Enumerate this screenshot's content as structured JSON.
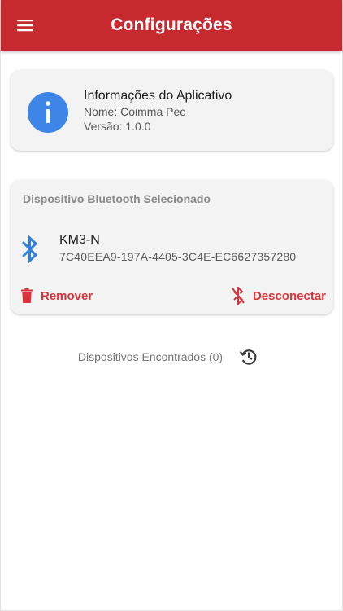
{
  "appbar": {
    "title": "Configurações",
    "bg_color": "#c62a2e",
    "menu_icon": "menu-icon"
  },
  "app_info": {
    "icon": "info-icon",
    "icon_color": "#3d86e8",
    "title": "Informações do Aplicativo",
    "name": "Nome: Coimma Pec",
    "version": "Versão: 1.0.0"
  },
  "bluetooth": {
    "header": "Dispositivo Bluetooth Selecionado",
    "icon": "bluetooth-icon",
    "icon_color": "#2f7fdc",
    "device_name": "KM3-N",
    "device_id": "7C40EEA9-197A-4405-3C4E-EC6627357280",
    "remove_label": "Remover",
    "remove_icon": "trash-icon",
    "disconnect_label": "Desconectar",
    "disconnect_icon": "bluetooth-disabled-icon",
    "action_color": "#d9343a"
  },
  "devices_found": {
    "label": "Dispositivos Encontrados (0)",
    "refresh_icon": "history-refresh-icon"
  }
}
